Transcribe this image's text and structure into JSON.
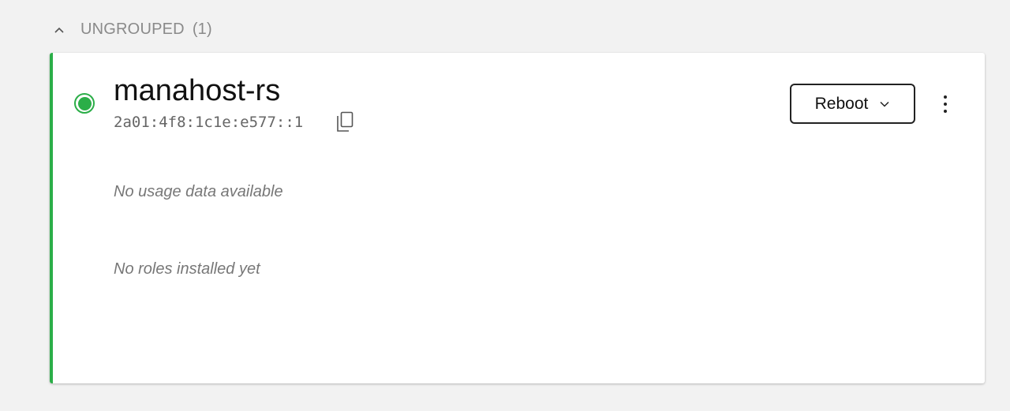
{
  "group": {
    "title": "UNGROUPED",
    "count": "(1)",
    "collapse_icon": "chevron-up-icon"
  },
  "server": {
    "name": "manahost-rs",
    "ip": "2a01:4f8:1c1e:e577::1",
    "status_color": "#2bae48",
    "copy_icon": "copy-icon",
    "usage_message": "No usage data available",
    "roles_message": "No roles installed yet"
  },
  "actions": {
    "reboot_label": "Reboot",
    "dropdown_icon": "chevron-down-icon",
    "more_icon": "kebab-menu-icon"
  }
}
